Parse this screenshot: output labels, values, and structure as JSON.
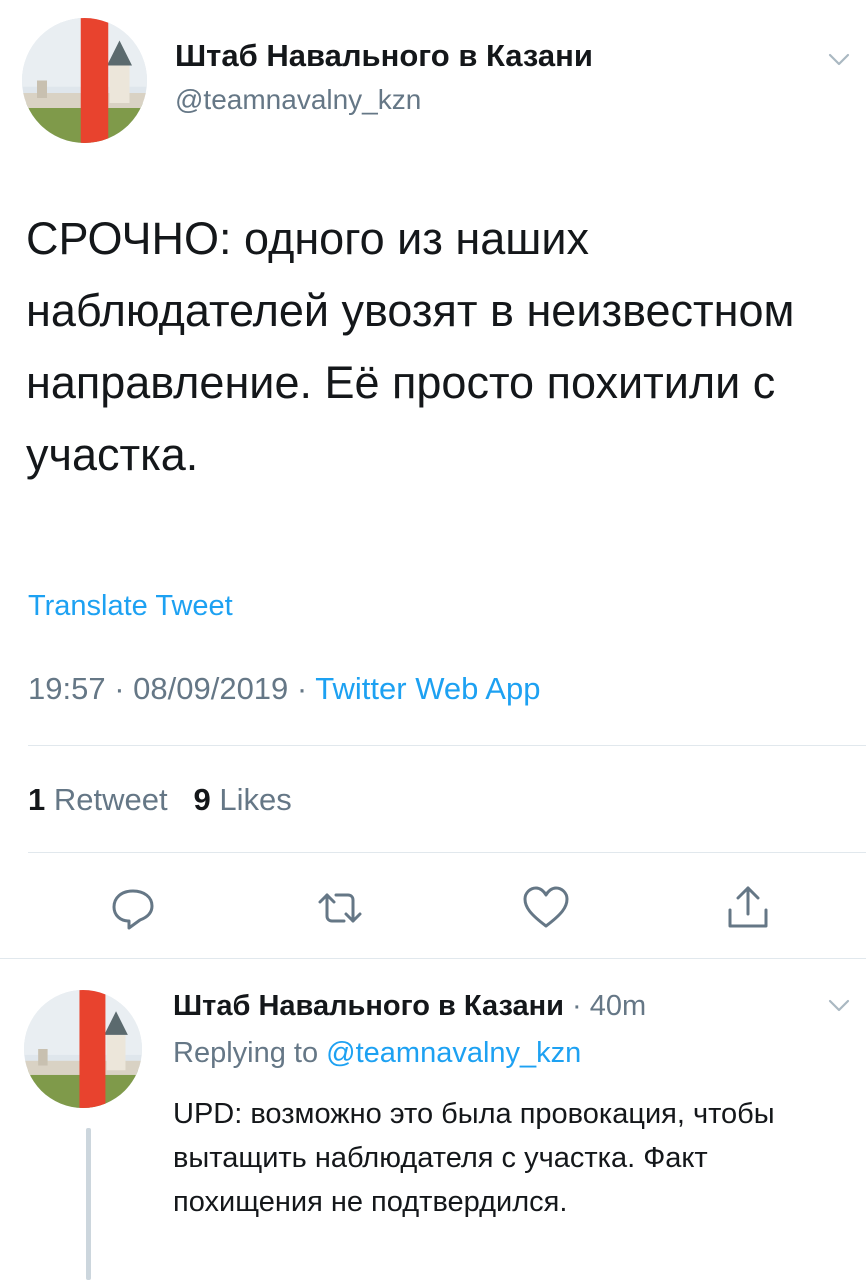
{
  "main_tweet": {
    "author_name": "Штаб Навального в Казани",
    "author_handle": "@teamnavalny_kzn",
    "text": "СРОЧНО: одного из наших наблюдателей увозят в неизвестном направление. Её просто похитили с участка.",
    "translate_label": "Translate Tweet",
    "time": "19:57",
    "date": "08/09/2019",
    "separator": " · ",
    "source": "Twitter Web App",
    "retweets_count": "1",
    "retweets_label": "Retweet",
    "likes_count": "9",
    "likes_label": "Likes"
  },
  "actions": [
    {
      "name": "reply",
      "icon": "reply-icon"
    },
    {
      "name": "retweet",
      "icon": "retweet-icon"
    },
    {
      "name": "like",
      "icon": "heart-icon"
    },
    {
      "name": "share",
      "icon": "share-icon"
    }
  ],
  "reply_tweet": {
    "author_name": "Штаб Навального в Казани",
    "time_separator": " · ",
    "time_ago": "40m",
    "replying_label": "Replying to ",
    "replying_handle": "@teamnavalny_kzn",
    "text": "UPD: возможно это была провокация, чтобы вытащить наблюдателя с участка. Факт похищения не подтвердился."
  },
  "colors": {
    "accent": "#1da1f2",
    "secondary_text": "#657786",
    "divider": "#e1e8ed",
    "brand_red": "#e8432e"
  }
}
